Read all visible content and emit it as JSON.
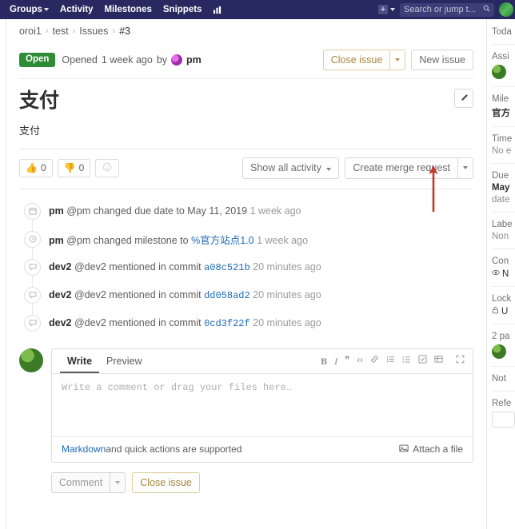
{
  "navbar": {
    "items": [
      {
        "label": "Groups",
        "icon": "chevron-down-icon",
        "has_caret": true
      },
      {
        "label": "Activity",
        "has_caret": false
      },
      {
        "label": "Milestones",
        "has_caret": false
      },
      {
        "label": "Snippets",
        "has_caret": false
      }
    ],
    "chart_icon": "chart-icon",
    "plus_label": "+",
    "search": {
      "placeholder": "Search or jump t...",
      "value": "",
      "icon": "search-icon"
    },
    "avatar": "user-avatar"
  },
  "breadcrumb": {
    "items": [
      "oroi1",
      "test",
      "Issues",
      "#3"
    ],
    "separator": "›"
  },
  "issue": {
    "state_badge": "Open",
    "opened_prefix": "Opened",
    "opened_time": "1 week ago",
    "opened_by": "by",
    "author": "pm",
    "close_button": "Close issue",
    "new_issue_button": "New issue",
    "title": "支付",
    "description": "支付",
    "edit_icon": "pencil-icon"
  },
  "reactions": [
    {
      "name": "thumbsup",
      "glyph": "👍",
      "count": "0"
    },
    {
      "name": "thumbsdown",
      "glyph": "👎",
      "count": "0"
    }
  ],
  "add_reaction_icon": "smiley-icon",
  "activity_toolbar": {
    "filter_label": "Show all activity",
    "merge_request_label": "Create merge request"
  },
  "activity": [
    {
      "icon": "calendar-icon",
      "user": "pm",
      "handle": "@pm",
      "action": "changed due date to",
      "target": "May 11, 2019",
      "target_type": "plain",
      "timestamp": "1 week ago"
    },
    {
      "icon": "clock-icon",
      "user": "pm",
      "handle": "@pm",
      "action": "changed milestone to",
      "target": "%官方站点1.0",
      "target_type": "link",
      "timestamp": "1 week ago"
    },
    {
      "icon": "comment-icon",
      "user": "dev2",
      "handle": "@dev2",
      "action": "mentioned in commit",
      "target": "a08c521b",
      "target_type": "mono",
      "timestamp": "20 minutes ago"
    },
    {
      "icon": "comment-icon",
      "user": "dev2",
      "handle": "@dev2",
      "action": "mentioned in commit",
      "target": "dd058ad2",
      "target_type": "mono",
      "timestamp": "20 minutes ago"
    },
    {
      "icon": "comment-icon",
      "user": "dev2",
      "handle": "@dev2",
      "action": "mentioned in commit",
      "target": "0cd3f22f",
      "target_type": "mono",
      "timestamp": "20 minutes ago"
    }
  ],
  "comment_form": {
    "avatar": "current-user-avatar",
    "tabs": [
      {
        "label": "Write",
        "active": true
      },
      {
        "label": "Preview",
        "active": false
      }
    ],
    "toolbar": [
      {
        "name": "bold-icon",
        "glyph": "B"
      },
      {
        "name": "italic-icon",
        "glyph": "I"
      },
      {
        "name": "quote-icon",
        "glyph": "❞"
      },
      {
        "name": "code-icon",
        "glyph": "‹›"
      },
      {
        "name": "link-icon",
        "glyph": "🔗"
      },
      {
        "name": "bullet-list-icon",
        "glyph": "☰"
      },
      {
        "name": "numbered-list-icon",
        "glyph": "⒊"
      },
      {
        "name": "task-list-icon",
        "glyph": "☑"
      },
      {
        "name": "table-icon",
        "glyph": "▦"
      },
      {
        "name": "fullscreen-icon",
        "glyph": "⛶"
      }
    ],
    "placeholder": "Write a comment or drag your files here…",
    "value": "",
    "markdown_link": "Markdown",
    "markdown_note": " and quick actions are supported",
    "attach_label": "Attach a file",
    "attach_icon": "image-icon",
    "comment_button": "Comment",
    "close_issue_button": "Close issue"
  },
  "sidebar": {
    "blocks": [
      {
        "name": "todo",
        "label": "Toda"
      },
      {
        "name": "assignee",
        "label": "Assi",
        "avatar": true
      },
      {
        "name": "milestone",
        "label": "Mile",
        "value": "官方",
        "bold": true
      },
      {
        "name": "time-tracking",
        "label": "Time",
        "value": "No e",
        "muted": true
      },
      {
        "name": "due-date",
        "label": "Due",
        "value": "May",
        "bold": true,
        "value2": "date"
      },
      {
        "name": "labels",
        "label": "Labe",
        "value": "Non",
        "muted": true
      },
      {
        "name": "confidentiality",
        "label": "Con",
        "value": "N",
        "icon": "eye-icon"
      },
      {
        "name": "lock",
        "label": "Lock",
        "value": "U",
        "icon": "unlock-icon"
      },
      {
        "name": "participants",
        "label": "2 pa",
        "avatar": true
      },
      {
        "name": "notifications",
        "label": "Not"
      },
      {
        "name": "reference",
        "label": "Refe",
        "box": true
      }
    ]
  },
  "annotation": {
    "type": "red-arrow",
    "color": "#c0392b",
    "points_to": "Create merge request"
  }
}
